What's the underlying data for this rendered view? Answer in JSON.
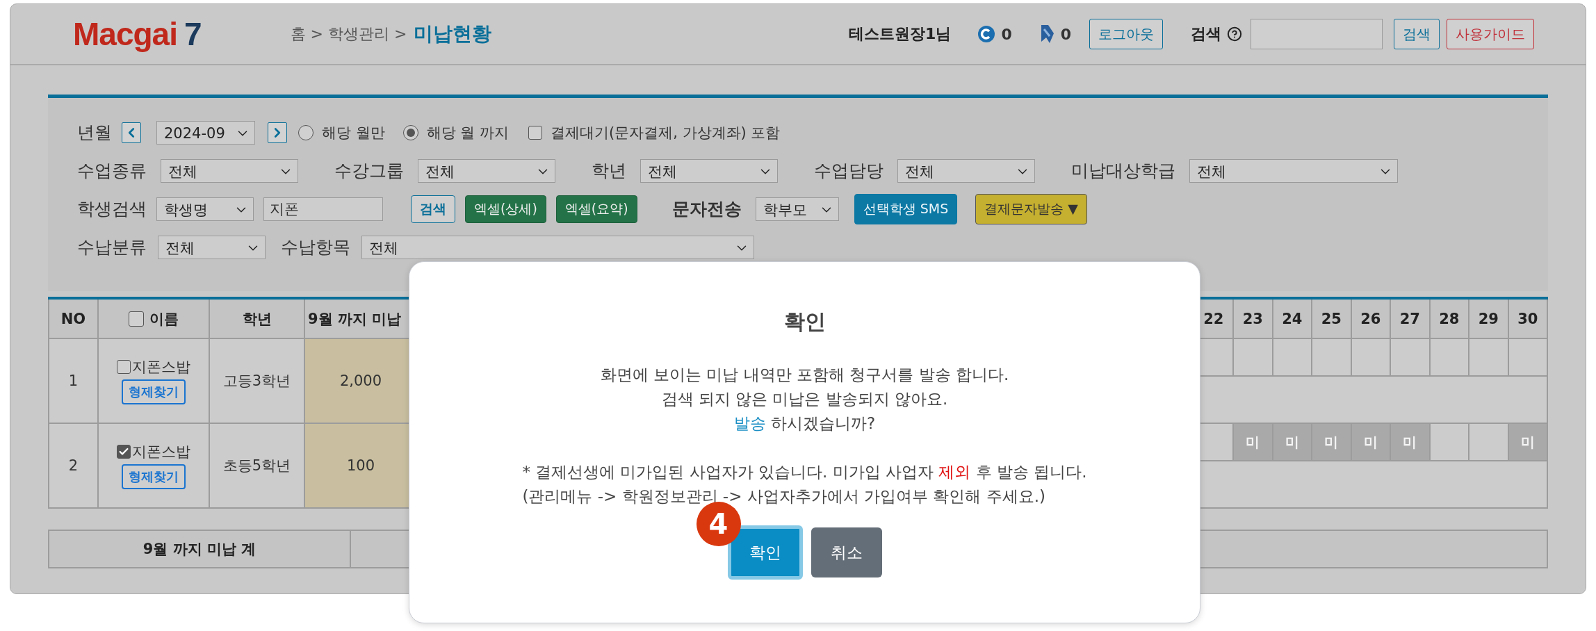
{
  "header": {
    "logo": {
      "word": "Macgai",
      "number": "7"
    },
    "breadcrumb": "홈 > 학생관리 >",
    "page_title": "미납현황",
    "user": "테스트원장1님",
    "counters": [
      {
        "kind": "coin",
        "value": "0"
      },
      {
        "kind": "ribbon",
        "value": "0"
      }
    ],
    "logout_button": "로그아웃",
    "search_label": "검색",
    "search_button": "검색",
    "guide_button": "사용가이드"
  },
  "filters": {
    "month": {
      "label": "년월",
      "value": "2024-09"
    },
    "radios": [
      {
        "label": "해당 월만",
        "selected": false
      },
      {
        "label": "해당 월 까지",
        "selected": true
      }
    ],
    "pending_checkbox": {
      "label": "결제대기(문자결제, 가상계좌) 포함",
      "checked": false
    },
    "selects": [
      {
        "label": "수업종류",
        "value": "전체"
      },
      {
        "label": "수강그룹",
        "value": "전체"
      },
      {
        "label": "학년",
        "value": "전체"
      },
      {
        "label": "수업담당",
        "value": "전체"
      },
      {
        "label": "미납대상학급",
        "value": "전체"
      }
    ],
    "student_search": {
      "label": "학생검색",
      "field": "학생명",
      "value": "지폰"
    },
    "actions": [
      {
        "kind": "outline",
        "label": "검색"
      },
      {
        "kind": "excel",
        "label": "엑셀(상세)"
      },
      {
        "kind": "excel",
        "label": "엑셀(요약)"
      }
    ],
    "sms": {
      "label": "문자전송",
      "target": "학부모",
      "buttons": [
        {
          "kind": "primary",
          "label": "선택학생 SMS"
        },
        {
          "kind": "warning",
          "label": "결제문자발송 ▼"
        }
      ]
    },
    "payment": [
      {
        "label": "수납분류",
        "value": "전체"
      },
      {
        "label": "수납항목",
        "value": "전체"
      }
    ]
  },
  "table": {
    "columns": [
      "NO",
      "이름",
      "학년",
      "9월 까지 미납"
    ],
    "select_all_checked": false,
    "day_columns": [
      "22",
      "23",
      "24",
      "25",
      "26",
      "27",
      "28",
      "29",
      "30"
    ],
    "rows": [
      {
        "no": "1",
        "name": "지폰스밥",
        "checked": false,
        "sibling_button": "형제찾기",
        "grade": "고등3학년",
        "amount": "2,000",
        "days": [
          {
            "unpaid": false
          },
          {
            "unpaid": false
          },
          {
            "unpaid": false
          },
          {
            "unpaid": false
          },
          {
            "unpaid": false
          },
          {
            "unpaid": false
          },
          {
            "unpaid": false
          },
          {
            "unpaid": false
          },
          {
            "unpaid": false
          }
        ]
      },
      {
        "no": "2",
        "name": "지폰스밥",
        "checked": true,
        "sibling_button": "형제찾기",
        "grade": "초등5학년",
        "amount": "100",
        "days": [
          {
            "unpaid": false
          },
          {
            "unpaid": true,
            "text": "미"
          },
          {
            "unpaid": true,
            "text": "미"
          },
          {
            "unpaid": true,
            "text": "미"
          },
          {
            "unpaid": true,
            "text": "미"
          },
          {
            "unpaid": true,
            "text": "미"
          },
          {
            "unpaid": false
          },
          {
            "unpaid": false
          },
          {
            "unpaid": true,
            "text": "미"
          }
        ]
      }
    ],
    "summary_label": "9월 까지 미납 계"
  },
  "dialog": {
    "title": "확인",
    "lines": [
      [
        {
          "text": "화면에 보이는 미납 내역만 포함해 청구서를 발송 합니다."
        }
      ],
      [
        {
          "text": "검색 되지 않은 미납은 발송되지 않아요."
        }
      ],
      [
        {
          "color": "#1b8fc4",
          "text": "발송"
        },
        {
          "text": " 하시겠습니까?"
        }
      ]
    ],
    "notes": [
      [
        {
          "text": "* 결제선생에 미가입된 사업자가 있습니다. 미가입 사업자 "
        },
        {
          "color": "#e01010",
          "text": "제외"
        },
        {
          "text": " 후 발송 됩니다."
        }
      ],
      [
        {
          "text": "(관리메뉴 -> 학원정보관리 -> 사업자추가에서 가입여부 확인해 주세요.)"
        }
      ]
    ],
    "buttons": [
      {
        "kind": "confirm",
        "label": "확인",
        "focused": true,
        "step": "4"
      },
      {
        "kind": "cancel",
        "label": "취소",
        "focused": false
      }
    ]
  }
}
